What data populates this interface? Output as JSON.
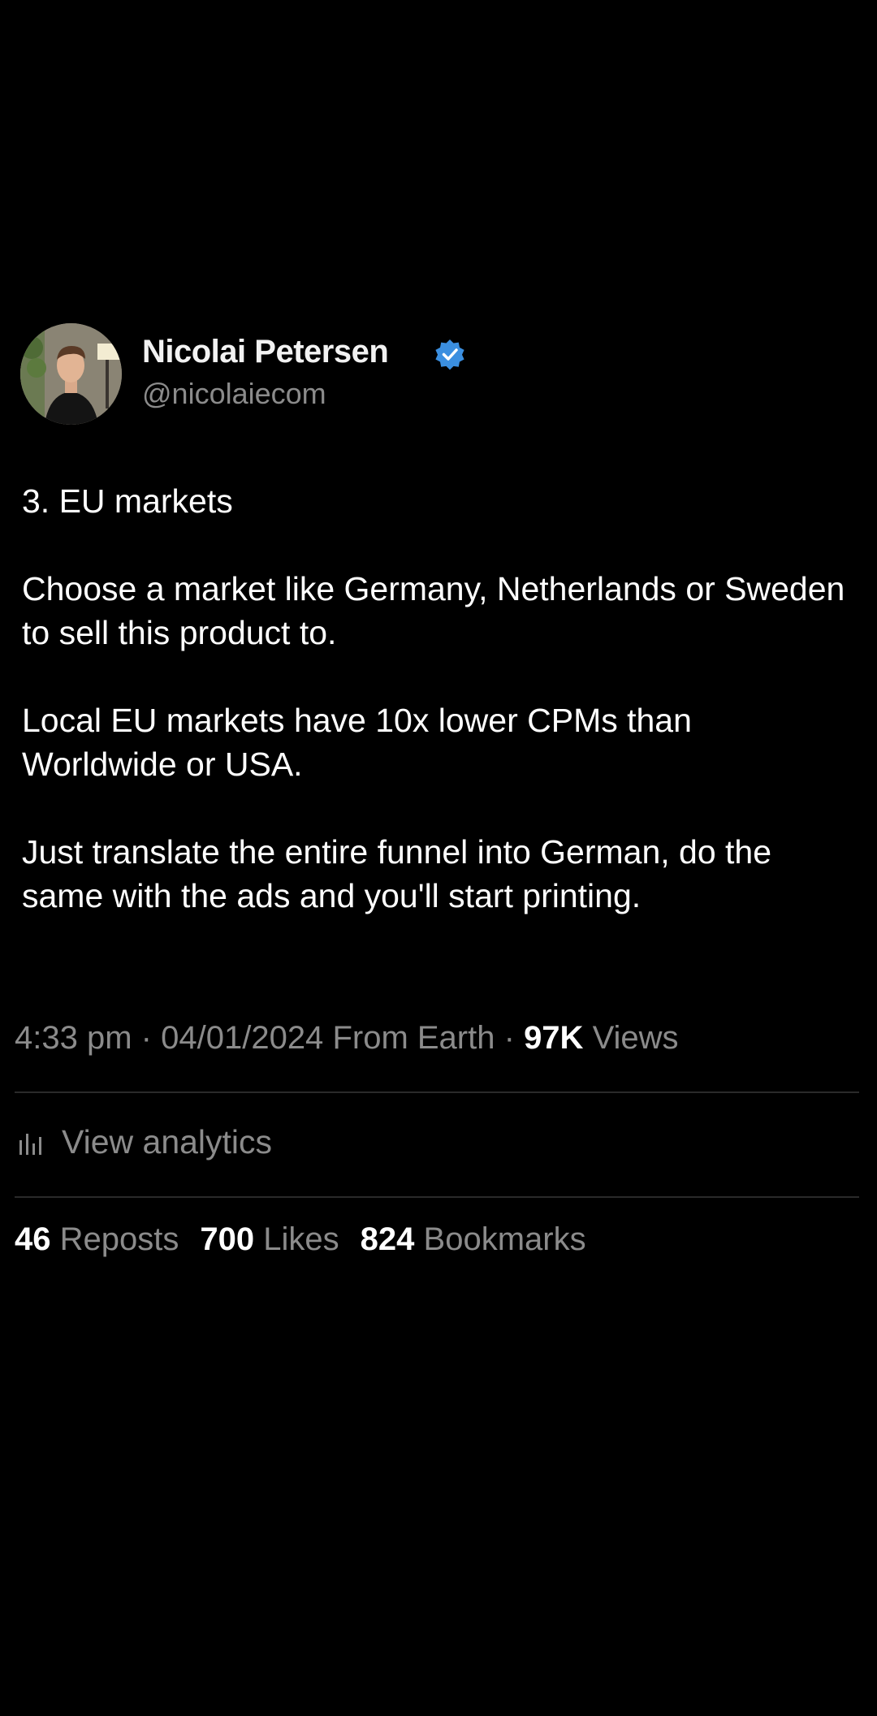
{
  "author": {
    "display_name": "Nicolai Petersen",
    "handle": "@nicolaiecom",
    "verified_icon": "verified-badge-icon",
    "verified_color": "#3b8fe0"
  },
  "post": {
    "paragraphs": [
      "3. EU markets",
      "Choose a market like Germany, Netherlands or Sweden to sell this product to.",
      "Local EU markets have 10x lower CPMs than Worldwide or USA.",
      "Just translate the entire funnel into German, do the same with the ads and you'll start printing."
    ],
    "time": "4:33 pm",
    "separator": "·",
    "date": "04/01/2024",
    "location": "From Earth",
    "views_count": "97K",
    "views_label": "Views"
  },
  "analytics": {
    "icon": "bar-chart-icon",
    "label": "View analytics"
  },
  "stats": {
    "reposts": {
      "count": "46",
      "label": "Reposts"
    },
    "likes": {
      "count": "700",
      "label": "Likes"
    },
    "bookmarks": {
      "count": "824",
      "label": "Bookmarks"
    }
  },
  "colors": {
    "background": "#000000",
    "text": "#ffffff",
    "secondary_text": "#8b8b8b",
    "divider": "#2a2a2a"
  }
}
